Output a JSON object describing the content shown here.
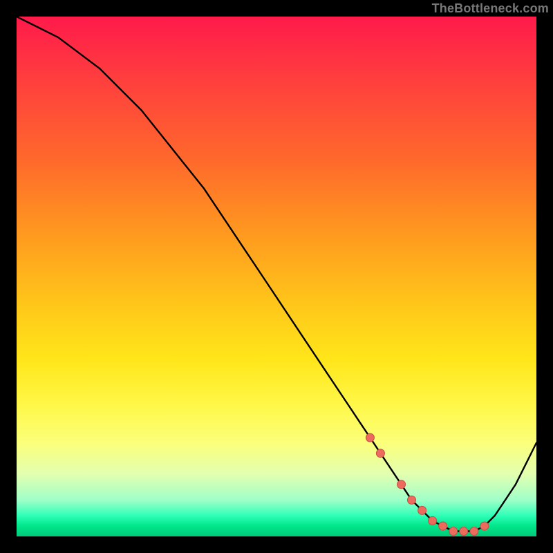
{
  "attribution": "TheBottleneck.com",
  "colors": {
    "curve_stroke": "#000000",
    "marker_fill": "#ec6b5f",
    "marker_stroke": "#c94a3e"
  },
  "chart_data": {
    "type": "line",
    "title": "",
    "xlabel": "",
    "ylabel": "",
    "xlim": [
      0,
      100
    ],
    "ylim": [
      0,
      100
    ],
    "grid": false,
    "legend": false,
    "series": [
      {
        "name": "bottleneck-curve",
        "x": [
          0,
          4,
          8,
          12,
          16,
          20,
          24,
          28,
          32,
          36,
          40,
          44,
          48,
          52,
          56,
          60,
          64,
          66,
          68,
          70,
          72,
          74,
          76,
          78,
          80,
          82,
          84,
          86,
          88,
          90,
          92,
          94,
          96,
          98,
          100
        ],
        "values": [
          100,
          98,
          96,
          93,
          90,
          86,
          82,
          77,
          72,
          67,
          61,
          55,
          49,
          43,
          37,
          31,
          25,
          22,
          19,
          16,
          13,
          10,
          7,
          5,
          3,
          2,
          1,
          1,
          1,
          2,
          4,
          7,
          10,
          14,
          18
        ]
      }
    ],
    "markers": {
      "series": "bottleneck-curve",
      "x": [
        68,
        70,
        74,
        76,
        78,
        80,
        82,
        84,
        86,
        88,
        90
      ],
      "r": 6
    }
  }
}
